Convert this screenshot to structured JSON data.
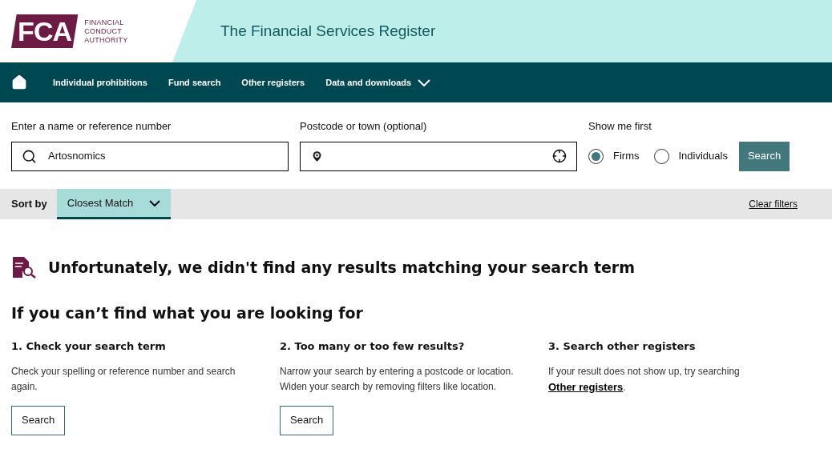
{
  "logo": {
    "mark": "FCA",
    "lines": [
      "FINANCIAL",
      "CONDUCT",
      "AUTHORITY"
    ]
  },
  "header": {
    "title": "The Financial Services Register"
  },
  "nav": {
    "items": [
      {
        "label": "Individual prohibitions",
        "dropdown": false
      },
      {
        "label": "Fund search",
        "dropdown": false
      },
      {
        "label": "Other registers",
        "dropdown": false
      },
      {
        "label": "Data and downloads",
        "dropdown": true
      }
    ]
  },
  "search": {
    "name_label": "Enter a name or reference number",
    "name_value": "Artosnomics",
    "location_label": "Postcode or town (optional)",
    "show_label": "Show me first",
    "options": [
      {
        "label": "Firms",
        "selected": true
      },
      {
        "label": "Individuals",
        "selected": false
      }
    ],
    "button": "Search"
  },
  "sort": {
    "label": "Sort by",
    "value": "Closest Match",
    "clear": "Clear filters"
  },
  "message": "Unfortunately, we didn't find any results matching your search term",
  "help": {
    "title": "If you can’t find what you are looking for",
    "columns": [
      {
        "heading": "1. Check your search term",
        "text": "Check your spelling or reference number and search again.",
        "button": "Search"
      },
      {
        "heading": "2. Too many or too few results?",
        "text": "Narrow your search by entering a postcode or location. Widen your search by removing filters like location.",
        "button": "Search"
      },
      {
        "heading": "3. Search other registers",
        "text": "If your result does not show up, try searching ",
        "link": "Other registers",
        "after": "."
      }
    ]
  }
}
